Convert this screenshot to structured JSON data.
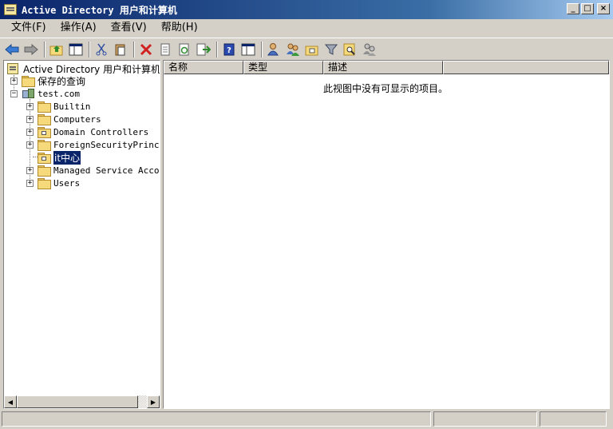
{
  "window": {
    "title": "Active Directory 用户和计算机",
    "controls": [
      "_",
      "□",
      "×"
    ]
  },
  "menu": [
    "文件(F)",
    "操作(A)",
    "查看(V)",
    "帮助(H)"
  ],
  "toolbar": {
    "icons": [
      "back-icon",
      "forward-icon",
      "up-folder-icon",
      "show-hide-console-tree-icon",
      "cut-icon",
      "paste-icon",
      "delete-icon",
      "properties-icon",
      "refresh-icon",
      "export-list-icon",
      "help-icon",
      "show-details-icon",
      "new-user-icon",
      "new-group-icon",
      "new-ou-icon",
      "filter-icon",
      "find-icon",
      "add-to-group-icon"
    ]
  },
  "tree": {
    "root": "Active Directory 用户和计算机",
    "saved_queries": "保存的查询",
    "domain": "test.com",
    "children": [
      "Builtin",
      "Computers",
      "Domain Controllers",
      "ForeignSecurityPrincipals",
      "it中心",
      "Managed Service Accounts",
      "Users"
    ],
    "selected": "it中心"
  },
  "list": {
    "columns": [
      "名称",
      "类型",
      "描述"
    ],
    "empty_message": "此视图中没有可显示的项目。"
  },
  "colors": {
    "titlebar_start": "#0a246a",
    "titlebar_end": "#a6caf0",
    "chrome": "#d4d0c8",
    "selection": "#0a246a"
  }
}
